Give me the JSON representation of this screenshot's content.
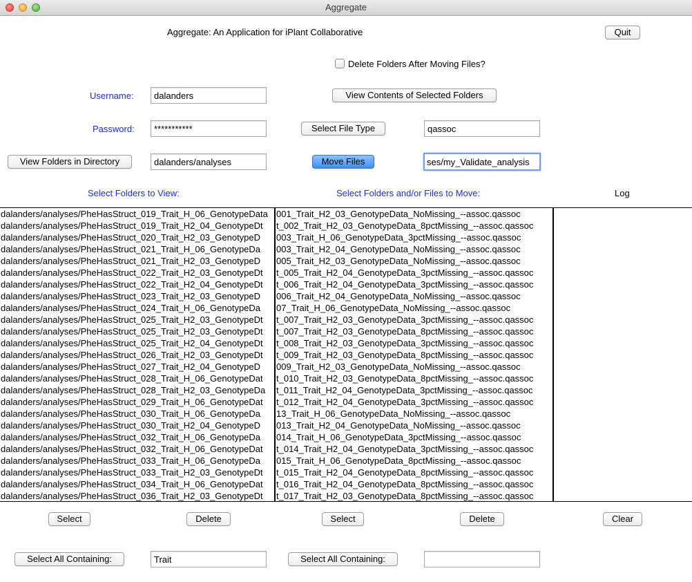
{
  "window": {
    "title": "Aggregate"
  },
  "header": {
    "app_title": "Aggregate: An Application for iPlant Collaborative",
    "quit_label": "Quit"
  },
  "options": {
    "delete_folders_label": "Delete Folders After Moving Files?",
    "delete_folders_checked": false
  },
  "login": {
    "username_label": "Username:",
    "username_value": "dalanders",
    "password_label": "Password:",
    "password_value": "***********"
  },
  "actions": {
    "view_contents_label": "View Contents of Selected Folders",
    "select_file_type_label": "Select File Type",
    "file_type_value": "qassoc",
    "view_folders_label": "View Folders in Directory",
    "directory_value": "dalanders/analyses",
    "move_files_label": "Move Files",
    "destination_value": "ses/my_Validate_analysis"
  },
  "columns": {
    "left_header": "Select Folders to View:",
    "mid_header": "Select Folders and/or Files to Move:",
    "log_header": "Log"
  },
  "left_list": [
    "dalanders/analyses/PheHasStruct_019_Trait_H_06_GenotypeData",
    "dalanders/analyses/PheHasStruct_019_Trait_H2_04_GenotypeDt",
    "dalanders/analyses/PheHasStruct_020_Trait_H2_03_GenotypeD",
    "dalanders/analyses/PheHasStruct_021_Trait_H_06_GenotypeDa",
    "dalanders/analyses/PheHasStruct_021_Trait_H2_03_GenotypeD",
    "dalanders/analyses/PheHasStruct_022_Trait_H2_03_GenotypeDt",
    "dalanders/analyses/PheHasStruct_022_Trait_H2_04_GenotypeDt",
    "dalanders/analyses/PheHasStruct_023_Trait_H2_03_GenotypeD",
    "dalanders/analyses/PheHasStruct_024_Trait_H_06_GenotypeDa",
    "dalanders/analyses/PheHasStruct_025_Trait_H2_03_GenotypeDt",
    "dalanders/analyses/PheHasStruct_025_Trait_H2_03_GenotypeDt",
    "dalanders/analyses/PheHasStruct_025_Trait_H2_04_GenotypeDt",
    "dalanders/analyses/PheHasStruct_026_Trait_H2_03_GenotypeDt",
    "dalanders/analyses/PheHasStruct_027_Trait_H2_04_GenotypeD",
    "dalanders/analyses/PheHasStruct_028_Trait_H_06_GenotypeDat",
    "dalanders/analyses/PheHasStruct_028_Trait_H2_03_GenotypeDa",
    "dalanders/analyses/PheHasStruct_029_Trait_H_06_GenotypeDat",
    "dalanders/analyses/PheHasStruct_030_Trait_H_06_GenotypeDa",
    "dalanders/analyses/PheHasStruct_030_Trait_H2_04_GenotypeD",
    "dalanders/analyses/PheHasStruct_032_Trait_H_06_GenotypeDa",
    "dalanders/analyses/PheHasStruct_032_Trait_H_06_GenotypeDat",
    "dalanders/analyses/PheHasStruct_033_Trait_H_06_GenotypeDa",
    "dalanders/analyses/PheHasStruct_033_Trait_H2_03_GenotypeDt",
    "dalanders/analyses/PheHasStruct_034_Trait_H_06_GenotypeDat",
    "dalanders/analyses/PheHasStruct_036_Trait_H2_03_GenotypeDt"
  ],
  "mid_list": [
    "001_Trait_H2_03_GenotypeData_NoMissing_--assoc.qassoc",
    "t_002_Trait_H2_03_GenotypeData_8pctMissing_--assoc.qassoc",
    "003_Trait_H_06_GenotypeData_3pctMissing_--assoc.qassoc",
    "003_Trait_H2_04_GenotypeData_NoMissing_--assoc.qassoc",
    "005_Trait_H2_03_GenotypeData_NoMissing_--assoc.qassoc",
    "t_005_Trait_H2_04_GenotypeData_3pctMissing_--assoc.qassoc",
    "t_006_Trait_H2_04_GenotypeData_3pctMissing_--assoc.qassoc",
    "006_Trait_H2_04_GenotypeData_NoMissing_--assoc.qassoc",
    "07_Trait_H_06_GenotypeData_NoMissing_--assoc.qassoc",
    "t_007_Trait_H2_03_GenotypeData_3pctMissing_--assoc.qassoc",
    "t_007_Trait_H2_03_GenotypeData_8pctMissing_--assoc.qassoc",
    "t_008_Trait_H2_03_GenotypeData_3pctMissing_--assoc.qassoc",
    "t_009_Trait_H2_03_GenotypeData_8pctMissing_--assoc.qassoc",
    "009_Trait_H2_03_GenotypeData_NoMissing_--assoc.qassoc",
    "t_010_Trait_H2_03_GenotypeData_8pctMissing_--assoc.qassoc",
    "t_011_Trait_H2_04_GenotypeData_3pctMissing_--assoc.qassoc",
    "t_012_Trait_H2_04_GenotypeData_3pctMissing_--assoc.qassoc",
    "13_Trait_H_06_GenotypeData_NoMissing_--assoc.qassoc",
    "013_Trait_H2_04_GenotypeData_NoMissing_--assoc.qassoc",
    "014_Trait_H_06_GenotypeData_3pctMissing_--assoc.qassoc",
    "t_014_Trait_H2_04_GenotypeData_3pctMissing_--assoc.qassoc",
    "015_Trait_H_06_GenotypeData_8pctMissing_--assoc.qassoc",
    "t_015_Trait_H2_04_GenotypeData_8pctMissing_--assoc.qassoc",
    "t_016_Trait_H2_04_GenotypeData_8pctMissing_--assoc.qassoc",
    "t_017_Trait_H2_03_GenotypeData_8pctMissing_--assoc.qassoc"
  ],
  "log_list": [],
  "bottom": {
    "select_left_label": "Select",
    "delete_left_label": "Delete",
    "select_mid_label": "Select",
    "delete_mid_label": "Delete",
    "clear_label": "Clear",
    "select_all_left_label": "Select All Containing:",
    "filter_left_value": "Trait",
    "select_all_mid_label": "Select All Containing:",
    "filter_mid_value": ""
  }
}
